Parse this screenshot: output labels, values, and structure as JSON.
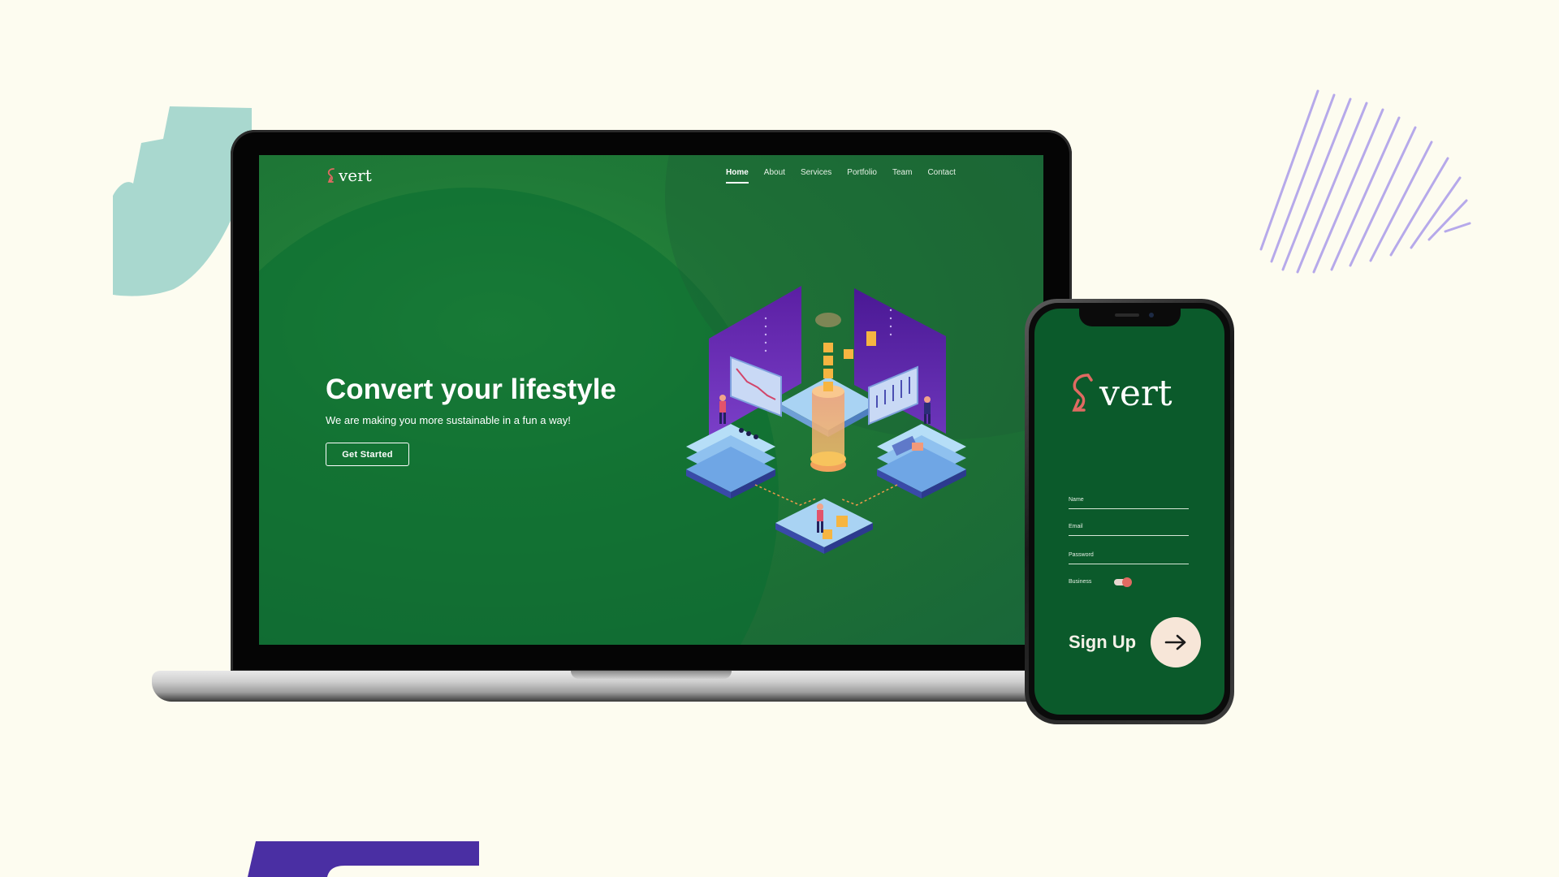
{
  "site": {
    "logo_text": "vert",
    "nav": [
      "Home",
      "About",
      "Services",
      "Portfolio",
      "Team",
      "Contact"
    ],
    "active_nav": "Home",
    "hero": {
      "title": "Convert your lifestyle",
      "subtitle": "We are making you more sustainable in a fun a way!",
      "cta": "Get Started"
    }
  },
  "phone_app": {
    "logo_text": "vert",
    "fields": {
      "name_label": "Name",
      "email_label": "Email",
      "password_label": "Password"
    },
    "toggle": {
      "label": "Business",
      "on": true
    },
    "signup_label": "Sign Up",
    "signup_icon": "arrow-right-icon"
  },
  "colors": {
    "background": "#fdfcf0",
    "site_green": "#1f7a37",
    "phone_green": "#0b5a2b",
    "accent_coral": "#e06a62",
    "deco_teal": "#a9d8cf",
    "deco_lavender": "#b6a9ea",
    "deco_purple": "#4a2fa3"
  }
}
